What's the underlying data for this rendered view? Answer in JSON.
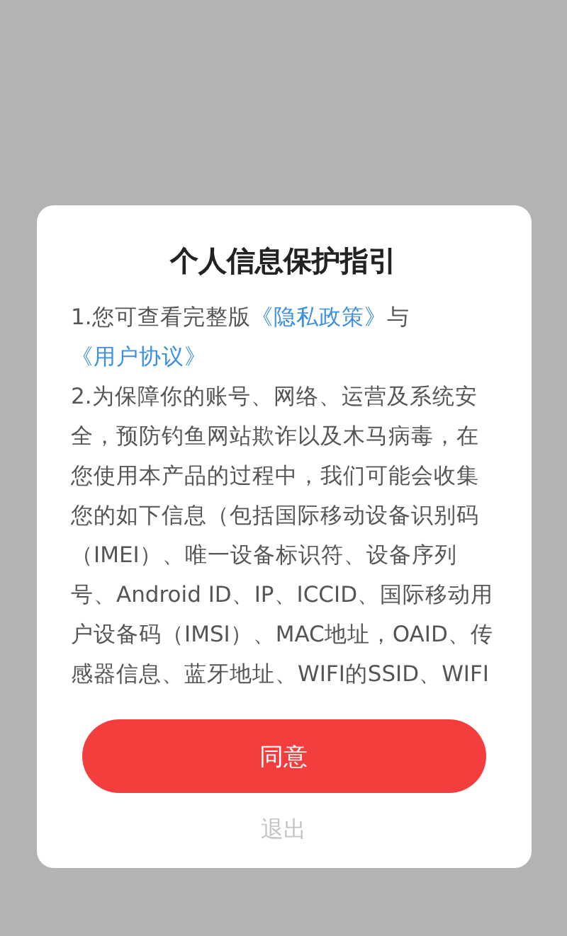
{
  "dialog": {
    "title": "个人信息保护指引",
    "paragraphs": [
      {
        "segments": [
          {
            "kind": "text",
            "text": "1.您可查看完整版"
          },
          {
            "kind": "link",
            "text": "《隐私政策》"
          },
          {
            "kind": "text",
            "text": "与"
          },
          {
            "kind": "link",
            "text": "《用户协议》"
          }
        ]
      },
      {
        "segments": [
          {
            "kind": "text",
            "text": "2.为保障你的账号、网络、运营及系统安全，预防钓鱼网站欺诈以及木马病毒，在您使用本产品的过程中，我们可能会收集您的如下信息（包括国际移动设备识别码（IMEI）、唯一设备标识符、设备序列号、Android ID、IP、ICCID、国际移动用户设备码（IMSI）、MAC地址，OAID、传感器信息、蓝牙地址、WIFI的SSID、WIFI"
          }
        ]
      }
    ],
    "agree_button": "同意",
    "exit_button": "退出"
  }
}
